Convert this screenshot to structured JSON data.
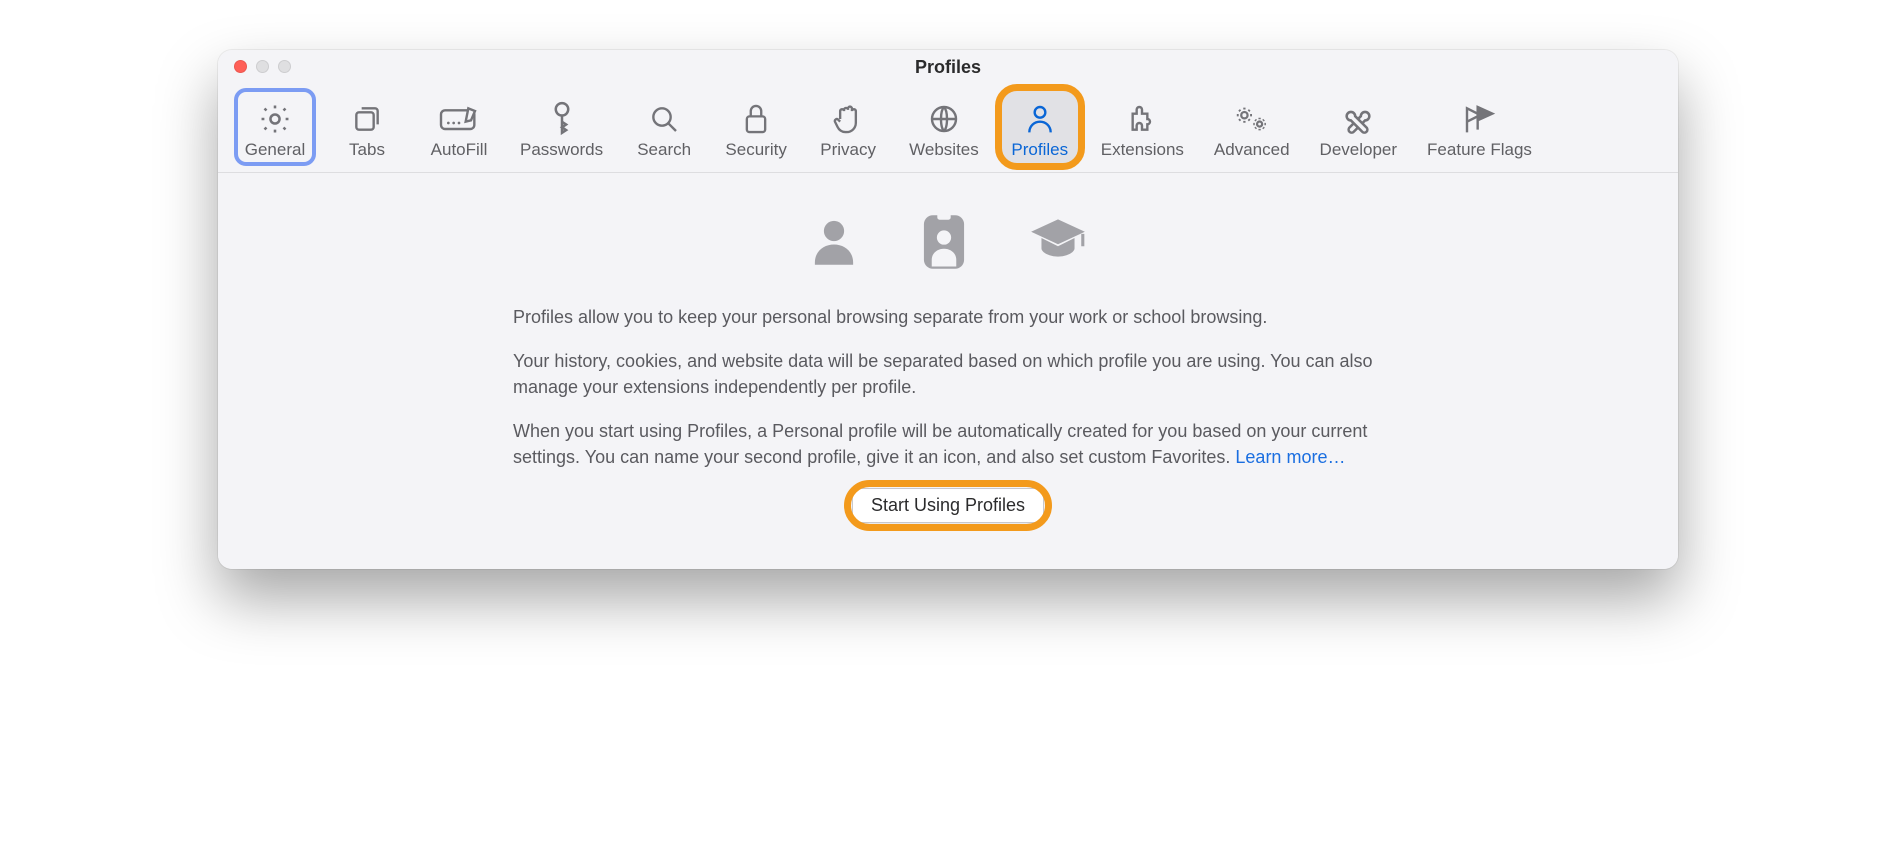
{
  "window": {
    "title": "Profiles"
  },
  "toolbar": {
    "tabs": [
      {
        "label": "General"
      },
      {
        "label": "Tabs"
      },
      {
        "label": "AutoFill"
      },
      {
        "label": "Passwords"
      },
      {
        "label": "Search"
      },
      {
        "label": "Security"
      },
      {
        "label": "Privacy"
      },
      {
        "label": "Websites"
      },
      {
        "label": "Profiles"
      },
      {
        "label": "Extensions"
      },
      {
        "label": "Advanced"
      },
      {
        "label": "Developer"
      },
      {
        "label": "Feature Flags"
      }
    ]
  },
  "profiles": {
    "para1": "Profiles allow you to keep your personal browsing separate from your work or school browsing.",
    "para2": "Your history, cookies, and website data will be separated based on which profile you are using. You can also manage your extensions independently per profile.",
    "para3_a": "When you start using Profiles, a Personal profile will be automatically created for you based on your current settings. You can name your second profile, give it an icon, and also set custom Favorites. ",
    "learn_more": "Learn more…",
    "button": "Start Using Profiles"
  }
}
